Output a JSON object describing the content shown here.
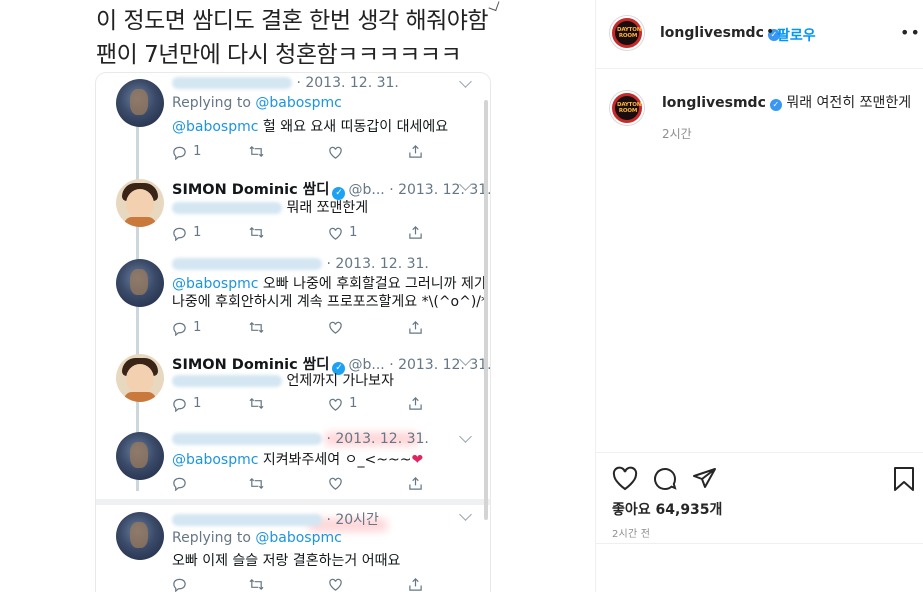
{
  "post_image": {
    "caption_lines": [
      "이 정도면 쌈디도 결혼 한번 생각 해줘야함",
      "팬이 7년만에 다시 청혼함ㅋㅋㅋㅋㅋㅋ"
    ],
    "tweets": [
      {
        "author": "fan",
        "date": "· 2013. 12. 31.",
        "replying_label": "Replying to",
        "replying_handle": "@babospmc",
        "mention": "@babospmc",
        "text": "헐 왜요 요새 띠동갑이 대세에요",
        "reply_count": "1",
        "like_count": ""
      },
      {
        "author": "simon",
        "name": "SIMON Dominic 쌈디",
        "handle": "@b...",
        "date": "· 2013. 12. 31.",
        "text": "뭐래 쪼맨한게",
        "reply_count": "1",
        "like_count": "1"
      },
      {
        "author": "fan",
        "date": "· 2013. 12. 31.",
        "mention": "@babospmc",
        "text_line1": "오빠 나중에 후회할걸요 그러니까 제가",
        "text_line2": "나중에 후회안하시게 계속 프로포즈할게요 *\\(^o^)/*",
        "reply_count": "1",
        "like_count": ""
      },
      {
        "author": "simon",
        "name": "SIMON Dominic 쌈디",
        "handle": "@b...",
        "date": "· 2013. 12. 31.",
        "text": "언제까지 가나보자",
        "reply_count": "1",
        "like_count": "1"
      },
      {
        "author": "fan",
        "date": "· 2013. 12. 31.",
        "mention": "@babospmc",
        "text": "지켜봐주세여 ㅇ_<~~~",
        "heart": "❤",
        "reply_count": "",
        "like_count": ""
      },
      {
        "author": "fan",
        "date": "· 20시간",
        "replying_label": "Replying to",
        "replying_handle": "@babospmc",
        "text": "오빠 이제 슬슬 저랑 결혼하는거 어때요"
      }
    ]
  },
  "panel": {
    "header": {
      "logo_text": "DAYTONA ROOM",
      "username": "longlivesmdc",
      "verified": "✓",
      "separator": "•",
      "follow_label": "팔로우",
      "more_label": "•••"
    },
    "comment": {
      "username": "longlivesmdc",
      "verified": "✓",
      "text": "뭐래 여전히 쪼맨한게",
      "time": "2시간"
    },
    "likes_text": "좋아요 64,935개",
    "post_time": "2시간 전"
  },
  "colors": {
    "twitter_blue": "#1da1f2",
    "instagram_link": "#0095f6",
    "heart_red": "#e0245e"
  }
}
